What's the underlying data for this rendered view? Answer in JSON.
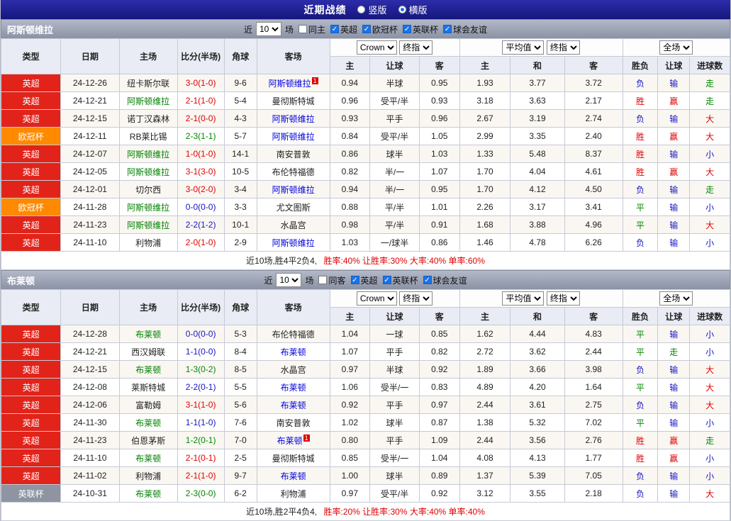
{
  "page": {
    "title": "近期战绩",
    "view_options": [
      {
        "label": "竖版",
        "selected": false
      },
      {
        "label": "横版",
        "selected": true
      }
    ]
  },
  "table_header": {
    "type": "类型",
    "date": "日期",
    "home": "主场",
    "score": "比分(半场)",
    "corner": "角球",
    "away": "客场",
    "asia_home": "主",
    "asia_handicap": "让球",
    "asia_away": "客",
    "euro_home": "主",
    "euro_draw": "和",
    "euro_away": "客",
    "result_wl": "胜负",
    "result_handicap": "让球",
    "result_goals": "进球数"
  },
  "sections": [
    {
      "team": "阿斯顿维拉",
      "filter": {
        "prefix": "近",
        "count": "10",
        "suffix": "场",
        "checkboxes": [
          {
            "label": "同主",
            "checked": false
          },
          {
            "label": "英超",
            "checked": true
          },
          {
            "label": "欧冠杯",
            "checked": true
          },
          {
            "label": "英联杯",
            "checked": true
          },
          {
            "label": "球会友谊",
            "checked": true
          }
        ]
      },
      "selects": {
        "company": "Crown",
        "odds_time1": "终指",
        "average": "平均值",
        "odds_time2": "终指",
        "scope": "全场"
      },
      "rows": [
        {
          "type": "英超",
          "type_color": "#e2231a",
          "date": "24-12-26",
          "home": "纽卡斯尔联",
          "home_subject": false,
          "score": "3-0(1-0)",
          "score_color": "red",
          "corners": "9-6",
          "away": "阿斯顿维拉",
          "away_subject": true,
          "away_badge": "1",
          "asia": [
            "0.94",
            "半球",
            "0.95"
          ],
          "euro": [
            "1.93",
            "3.77",
            "3.72"
          ],
          "results": [
            [
              "负",
              "blue"
            ],
            [
              "输",
              "blue"
            ],
            [
              "走",
              "green"
            ]
          ]
        },
        {
          "type": "英超",
          "type_color": "#e2231a",
          "date": "24-12-21",
          "home": "阿斯顿维拉",
          "home_subject": true,
          "score": "2-1(1-0)",
          "score_color": "red",
          "corners": "5-4",
          "away": "曼彻斯特城",
          "away_subject": false,
          "asia": [
            "0.96",
            "受平/半",
            "0.93"
          ],
          "euro": [
            "3.18",
            "3.63",
            "2.17"
          ],
          "results": [
            [
              "胜",
              "red"
            ],
            [
              "赢",
              "red"
            ],
            [
              "走",
              "green"
            ]
          ]
        },
        {
          "type": "英超",
          "type_color": "#e2231a",
          "date": "24-12-15",
          "home": "诺丁汉森林",
          "home_subject": false,
          "score": "2-1(0-0)",
          "score_color": "red",
          "corners": "4-3",
          "away": "阿斯顿维拉",
          "away_subject": true,
          "asia": [
            "0.93",
            "平手",
            "0.96"
          ],
          "euro": [
            "2.67",
            "3.19",
            "2.74"
          ],
          "results": [
            [
              "负",
              "blue"
            ],
            [
              "输",
              "blue"
            ],
            [
              "大",
              "red"
            ]
          ]
        },
        {
          "type": "欧冠杯",
          "type_color": "#ff8a00",
          "date": "24-12-11",
          "home": "RB莱比锡",
          "home_subject": false,
          "score": "2-3(1-1)",
          "score_color": "green",
          "corners": "5-7",
          "away": "阿斯顿维拉",
          "away_subject": true,
          "asia": [
            "0.84",
            "受平/半",
            "1.05"
          ],
          "euro": [
            "2.99",
            "3.35",
            "2.40"
          ],
          "results": [
            [
              "胜",
              "red"
            ],
            [
              "赢",
              "red"
            ],
            [
              "大",
              "red"
            ]
          ]
        },
        {
          "type": "英超",
          "type_color": "#e2231a",
          "date": "24-12-07",
          "home": "阿斯顿维拉",
          "home_subject": true,
          "score": "1-0(1-0)",
          "score_color": "red",
          "corners": "14-1",
          "away": "南安普敦",
          "away_subject": false,
          "asia": [
            "0.86",
            "球半",
            "1.03"
          ],
          "euro": [
            "1.33",
            "5.48",
            "8.37"
          ],
          "results": [
            [
              "胜",
              "red"
            ],
            [
              "输",
              "blue"
            ],
            [
              "小",
              "blue"
            ]
          ]
        },
        {
          "type": "英超",
          "type_color": "#e2231a",
          "date": "24-12-05",
          "home": "阿斯顿维拉",
          "home_subject": true,
          "score": "3-1(3-0)",
          "score_color": "red",
          "corners": "10-5",
          "away": "布伦特福德",
          "away_subject": false,
          "asia": [
            "0.82",
            "半/一",
            "1.07"
          ],
          "euro": [
            "1.70",
            "4.04",
            "4.61"
          ],
          "results": [
            [
              "胜",
              "red"
            ],
            [
              "赢",
              "red"
            ],
            [
              "大",
              "red"
            ]
          ]
        },
        {
          "type": "英超",
          "type_color": "#e2231a",
          "date": "24-12-01",
          "home": "切尔西",
          "home_subject": false,
          "score": "3-0(2-0)",
          "score_color": "red",
          "corners": "3-4",
          "away": "阿斯顿维拉",
          "away_subject": true,
          "asia": [
            "0.94",
            "半/一",
            "0.95"
          ],
          "euro": [
            "1.70",
            "4.12",
            "4.50"
          ],
          "results": [
            [
              "负",
              "blue"
            ],
            [
              "输",
              "blue"
            ],
            [
              "走",
              "green"
            ]
          ]
        },
        {
          "type": "欧冠杯",
          "type_color": "#ff8a00",
          "date": "24-11-28",
          "home": "阿斯顿维拉",
          "home_subject": true,
          "score": "0-0(0-0)",
          "score_color": "blue",
          "corners": "3-3",
          "away": "尤文图斯",
          "away_subject": false,
          "asia": [
            "0.88",
            "平/半",
            "1.01"
          ],
          "euro": [
            "2.26",
            "3.17",
            "3.41"
          ],
          "results": [
            [
              "平",
              "green"
            ],
            [
              "输",
              "blue"
            ],
            [
              "小",
              "blue"
            ]
          ]
        },
        {
          "type": "英超",
          "type_color": "#e2231a",
          "date": "24-11-23",
          "home": "阿斯顿维拉",
          "home_subject": true,
          "score": "2-2(1-2)",
          "score_color": "blue",
          "corners": "10-1",
          "away": "水晶宫",
          "away_subject": false,
          "asia": [
            "0.98",
            "平/半",
            "0.91"
          ],
          "euro": [
            "1.68",
            "3.88",
            "4.96"
          ],
          "results": [
            [
              "平",
              "green"
            ],
            [
              "输",
              "blue"
            ],
            [
              "大",
              "red"
            ]
          ]
        },
        {
          "type": "英超",
          "type_color": "#e2231a",
          "date": "24-11-10",
          "home": "利物浦",
          "home_subject": false,
          "score": "2-0(1-0)",
          "score_color": "red",
          "corners": "2-9",
          "away": "阿斯顿维拉",
          "away_subject": true,
          "asia": [
            "1.03",
            "一/球半",
            "0.86"
          ],
          "euro": [
            "1.46",
            "4.78",
            "6.26"
          ],
          "results": [
            [
              "负",
              "blue"
            ],
            [
              "输",
              "blue"
            ],
            [
              "小",
              "blue"
            ]
          ]
        }
      ],
      "summary": {
        "plain": "近10场,胜4平2负4,",
        "rates": "胜率:40% 让胜率:30% 大率:40% 单率:60%"
      }
    },
    {
      "team": "布莱顿",
      "filter": {
        "prefix": "近",
        "count": "10",
        "suffix": "场",
        "checkboxes": [
          {
            "label": "同客",
            "checked": false
          },
          {
            "label": "英超",
            "checked": true
          },
          {
            "label": "英联杯",
            "checked": true
          },
          {
            "label": "球会友谊",
            "checked": true
          }
        ]
      },
      "selects": {
        "company": "Crown",
        "odds_time1": "终指",
        "average": "平均值",
        "odds_time2": "终指",
        "scope": "全场"
      },
      "rows": [
        {
          "type": "英超",
          "type_color": "#e2231a",
          "date": "24-12-28",
          "home": "布莱顿",
          "home_subject": true,
          "score": "0-0(0-0)",
          "score_color": "blue",
          "corners": "5-3",
          "away": "布伦特福德",
          "away_subject": false,
          "asia": [
            "1.04",
            "一球",
            "0.85"
          ],
          "euro": [
            "1.62",
            "4.44",
            "4.83"
          ],
          "results": [
            [
              "平",
              "green"
            ],
            [
              "输",
              "blue"
            ],
            [
              "小",
              "blue"
            ]
          ]
        },
        {
          "type": "英超",
          "type_color": "#e2231a",
          "date": "24-12-21",
          "home": "西汉姆联",
          "home_subject": false,
          "score": "1-1(0-0)",
          "score_color": "blue",
          "corners": "8-4",
          "away": "布莱顿",
          "away_subject": true,
          "asia": [
            "1.07",
            "平手",
            "0.82"
          ],
          "euro": [
            "2.72",
            "3.62",
            "2.44"
          ],
          "results": [
            [
              "平",
              "green"
            ],
            [
              "走",
              "green"
            ],
            [
              "小",
              "blue"
            ]
          ]
        },
        {
          "type": "英超",
          "type_color": "#e2231a",
          "date": "24-12-15",
          "home": "布莱顿",
          "home_subject": true,
          "score": "1-3(0-2)",
          "score_color": "green",
          "corners": "8-5",
          "away": "水晶宫",
          "away_subject": false,
          "asia": [
            "0.97",
            "半球",
            "0.92"
          ],
          "euro": [
            "1.89",
            "3.66",
            "3.98"
          ],
          "results": [
            [
              "负",
              "blue"
            ],
            [
              "输",
              "blue"
            ],
            [
              "大",
              "red"
            ]
          ]
        },
        {
          "type": "英超",
          "type_color": "#e2231a",
          "date": "24-12-08",
          "home": "莱斯特城",
          "home_subject": false,
          "score": "2-2(0-1)",
          "score_color": "blue",
          "corners": "5-5",
          "away": "布莱顿",
          "away_subject": true,
          "asia": [
            "1.06",
            "受半/一",
            "0.83"
          ],
          "euro": [
            "4.89",
            "4.20",
            "1.64"
          ],
          "results": [
            [
              "平",
              "green"
            ],
            [
              "输",
              "blue"
            ],
            [
              "大",
              "red"
            ]
          ]
        },
        {
          "type": "英超",
          "type_color": "#e2231a",
          "date": "24-12-06",
          "home": "富勒姆",
          "home_subject": false,
          "score": "3-1(1-0)",
          "score_color": "red",
          "corners": "5-6",
          "away": "布莱顿",
          "away_subject": true,
          "asia": [
            "0.92",
            "平手",
            "0.97"
          ],
          "euro": [
            "2.44",
            "3.61",
            "2.75"
          ],
          "results": [
            [
              "负",
              "blue"
            ],
            [
              "输",
              "blue"
            ],
            [
              "大",
              "red"
            ]
          ]
        },
        {
          "type": "英超",
          "type_color": "#e2231a",
          "date": "24-11-30",
          "home": "布莱顿",
          "home_subject": true,
          "score": "1-1(1-0)",
          "score_color": "blue",
          "corners": "7-6",
          "away": "南安普敦",
          "away_subject": false,
          "asia": [
            "1.02",
            "球半",
            "0.87"
          ],
          "euro": [
            "1.38",
            "5.32",
            "7.02"
          ],
          "results": [
            [
              "平",
              "green"
            ],
            [
              "输",
              "blue"
            ],
            [
              "小",
              "blue"
            ]
          ]
        },
        {
          "type": "英超",
          "type_color": "#e2231a",
          "date": "24-11-23",
          "home": "伯恩茅斯",
          "home_subject": false,
          "score": "1-2(0-1)",
          "score_color": "green",
          "corners": "7-0",
          "away": "布莱顿",
          "away_subject": true,
          "away_badge": "1",
          "asia": [
            "0.80",
            "平手",
            "1.09"
          ],
          "euro": [
            "2.44",
            "3.56",
            "2.76"
          ],
          "results": [
            [
              "胜",
              "red"
            ],
            [
              "赢",
              "red"
            ],
            [
              "走",
              "green"
            ]
          ]
        },
        {
          "type": "英超",
          "type_color": "#e2231a",
          "date": "24-11-10",
          "home": "布莱顿",
          "home_subject": true,
          "score": "2-1(0-1)",
          "score_color": "red",
          "corners": "2-5",
          "away": "曼彻斯特城",
          "away_subject": false,
          "asia": [
            "0.85",
            "受半/一",
            "1.04"
          ],
          "euro": [
            "4.08",
            "4.13",
            "1.77"
          ],
          "results": [
            [
              "胜",
              "red"
            ],
            [
              "赢",
              "red"
            ],
            [
              "小",
              "blue"
            ]
          ]
        },
        {
          "type": "英超",
          "type_color": "#e2231a",
          "date": "24-11-02",
          "home": "利物浦",
          "home_subject": false,
          "score": "2-1(1-0)",
          "score_color": "red",
          "corners": "9-7",
          "away": "布莱顿",
          "away_subject": true,
          "asia": [
            "1.00",
            "球半",
            "0.89"
          ],
          "euro": [
            "1.37",
            "5.39",
            "7.05"
          ],
          "results": [
            [
              "负",
              "blue"
            ],
            [
              "输",
              "blue"
            ],
            [
              "小",
              "blue"
            ]
          ]
        },
        {
          "type": "英联杯",
          "type_color": "#8e94a2",
          "date": "24-10-31",
          "home": "布莱顿",
          "home_subject": true,
          "score": "2-3(0-0)",
          "score_color": "green",
          "corners": "6-2",
          "away": "利物浦",
          "away_subject": false,
          "asia": [
            "0.97",
            "受平/半",
            "0.92"
          ],
          "euro": [
            "3.12",
            "3.55",
            "2.18"
          ],
          "results": [
            [
              "负",
              "blue"
            ],
            [
              "输",
              "blue"
            ],
            [
              "大",
              "red"
            ]
          ]
        }
      ],
      "summary": {
        "plain": "近10场,胜2平4负4,",
        "rates": "胜率:20% 让胜率:30% 大率:40% 单率:40%"
      }
    }
  ]
}
